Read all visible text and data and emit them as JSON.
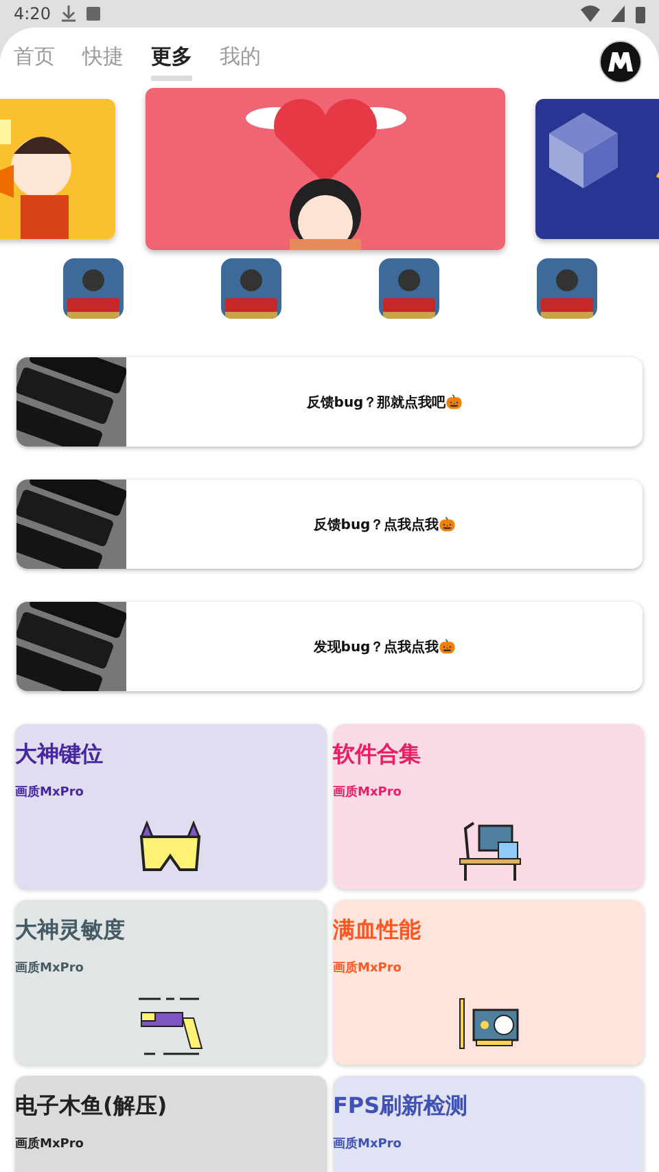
{
  "status_bar": {
    "time": "4:20"
  },
  "tabs": [
    {
      "label": "首页",
      "selected": false
    },
    {
      "label": "快捷",
      "selected": false
    },
    {
      "label": "更多",
      "selected": true
    },
    {
      "label": "我的",
      "selected": false
    }
  ],
  "feedback_cards": [
    {
      "text": "反馈bug？那就点我吧🎃"
    },
    {
      "text": "反馈bug？点我点我🎃"
    },
    {
      "text": "发现bug？点我点我🎃"
    }
  ],
  "feature_cards": [
    {
      "title": "大神键位",
      "subtitle": "画质MxPro",
      "color": "#4527a0",
      "kind": "goggles"
    },
    {
      "title": "软件合集",
      "subtitle": "画质MxPro",
      "color": "#e91e63",
      "kind": "desk"
    },
    {
      "title": "大神灵敏度",
      "subtitle": "画质MxPro",
      "color": "#455a64",
      "kind": "gun"
    },
    {
      "title": "满血性能",
      "subtitle": "画质MxPro",
      "color": "#ff5722",
      "kind": "gpu"
    },
    {
      "title": "电子木鱼(解压)",
      "subtitle": "画质MxPro",
      "color": "#212121",
      "kind": "none"
    },
    {
      "title": "FPS刷新检测",
      "subtitle": "画质MxPro",
      "color": "#3f51b5",
      "kind": "none"
    }
  ]
}
